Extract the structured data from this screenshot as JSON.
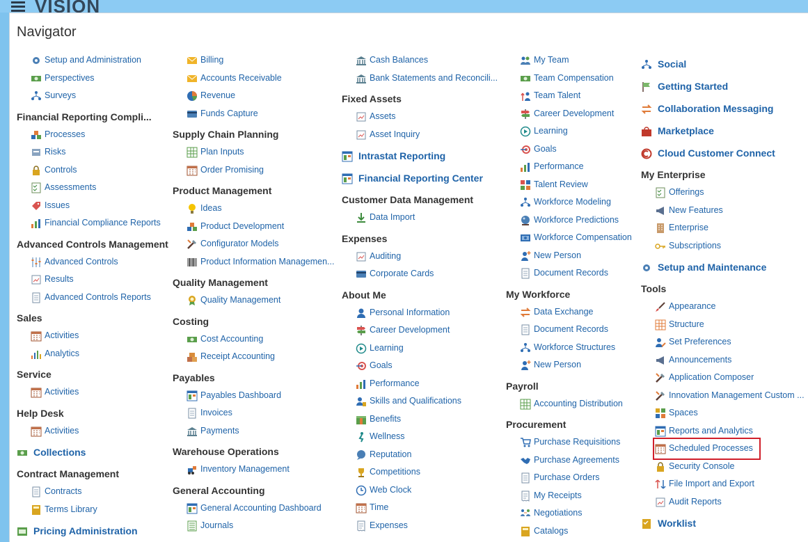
{
  "app": {
    "brand": "VISION"
  },
  "navigator": {
    "title": "Navigator",
    "columns": [
      [
        {
          "kind": "item",
          "label": "Setup and Administration",
          "icon": "gears-icon"
        },
        {
          "kind": "item",
          "label": "Perspectives",
          "icon": "money-icon"
        },
        {
          "kind": "item",
          "label": "Surveys",
          "icon": "hierarchy-icon"
        },
        {
          "kind": "head",
          "label": "Financial Reporting Compli..."
        },
        {
          "kind": "item",
          "label": "Processes",
          "icon": "blocks-icon"
        },
        {
          "kind": "item",
          "label": "Risks",
          "icon": "risk-icon"
        },
        {
          "kind": "item",
          "label": "Controls",
          "icon": "lock-icon"
        },
        {
          "kind": "item",
          "label": "Assessments",
          "icon": "checklist-icon"
        },
        {
          "kind": "item",
          "label": "Issues",
          "icon": "tag-icon"
        },
        {
          "kind": "item",
          "label": "Financial Compliance Reports",
          "icon": "bar-chart-icon"
        },
        {
          "kind": "head",
          "label": "Advanced Controls Management"
        },
        {
          "kind": "item",
          "label": "Advanced Controls",
          "icon": "sliders-icon"
        },
        {
          "kind": "item",
          "label": "Results",
          "icon": "report-icon"
        },
        {
          "kind": "item",
          "label": "Advanced Controls Reports",
          "icon": "document-icon"
        },
        {
          "kind": "head",
          "label": "Sales"
        },
        {
          "kind": "item",
          "label": "Activities",
          "icon": "calendar-icon"
        },
        {
          "kind": "item",
          "label": "Analytics",
          "icon": "analytics-icon"
        },
        {
          "kind": "head",
          "label": "Service"
        },
        {
          "kind": "item",
          "label": "Activities",
          "icon": "calendar-icon"
        },
        {
          "kind": "head",
          "label": "Help Desk"
        },
        {
          "kind": "item",
          "label": "Activities",
          "icon": "calendar-icon"
        },
        {
          "kind": "top",
          "label": "Collections",
          "icon": "money-icon"
        },
        {
          "kind": "head",
          "label": "Contract Management"
        },
        {
          "kind": "item",
          "label": "Contracts",
          "icon": "document-icon"
        },
        {
          "kind": "item",
          "label": "Terms Library",
          "icon": "book-icon"
        },
        {
          "kind": "top",
          "label": "Pricing Administration",
          "icon": "price-icon"
        }
      ],
      [
        {
          "kind": "item",
          "label": "Billing",
          "icon": "envelope-icon"
        },
        {
          "kind": "item",
          "label": "Accounts Receivable",
          "icon": "envelope-icon"
        },
        {
          "kind": "item",
          "label": "Revenue",
          "icon": "pie-chart-icon"
        },
        {
          "kind": "item",
          "label": "Funds Capture",
          "icon": "card-icon"
        },
        {
          "kind": "head",
          "label": "Supply Chain Planning"
        },
        {
          "kind": "item",
          "label": "Plan Inputs",
          "icon": "grid-icon"
        },
        {
          "kind": "item",
          "label": "Order Promising",
          "icon": "calendar-icon"
        },
        {
          "kind": "head",
          "label": "Product Management"
        },
        {
          "kind": "item",
          "label": "Ideas",
          "icon": "lightbulb-icon"
        },
        {
          "kind": "item",
          "label": "Product Development",
          "icon": "blocks-icon"
        },
        {
          "kind": "item",
          "label": "Configurator Models",
          "icon": "tools-icon"
        },
        {
          "kind": "item",
          "label": "Product Information Managemen...",
          "icon": "barcode-icon"
        },
        {
          "kind": "head",
          "label": "Quality Management"
        },
        {
          "kind": "item",
          "label": "Quality Management",
          "icon": "award-icon"
        },
        {
          "kind": "head",
          "label": "Costing"
        },
        {
          "kind": "item",
          "label": "Cost Accounting",
          "icon": "money-icon"
        },
        {
          "kind": "item",
          "label": "Receipt Accounting",
          "icon": "boxes-icon"
        },
        {
          "kind": "head",
          "label": "Payables"
        },
        {
          "kind": "item",
          "label": "Payables Dashboard",
          "icon": "dashboard-icon"
        },
        {
          "kind": "item",
          "label": "Invoices",
          "icon": "document-icon"
        },
        {
          "kind": "item",
          "label": "Payments",
          "icon": "bank-icon"
        },
        {
          "kind": "head",
          "label": "Warehouse Operations"
        },
        {
          "kind": "item",
          "label": "Inventory Management",
          "icon": "forklift-icon"
        },
        {
          "kind": "head",
          "label": "General Accounting"
        },
        {
          "kind": "item",
          "label": "General Accounting Dashboard",
          "icon": "dashboard-icon"
        },
        {
          "kind": "item",
          "label": "Journals",
          "icon": "ledger-icon"
        }
      ],
      [
        {
          "kind": "item",
          "label": "Cash Balances",
          "icon": "bank-icon"
        },
        {
          "kind": "item",
          "label": "Bank Statements and Reconcili...",
          "icon": "bank-icon"
        },
        {
          "kind": "head",
          "label": "Fixed Assets"
        },
        {
          "kind": "item",
          "label": "Assets",
          "icon": "report-icon"
        },
        {
          "kind": "item",
          "label": "Asset Inquiry",
          "icon": "report-icon"
        },
        {
          "kind": "top",
          "label": "Intrastat Reporting",
          "icon": "dashboard-icon"
        },
        {
          "kind": "top",
          "label": "Financial Reporting Center",
          "icon": "dashboard-icon"
        },
        {
          "kind": "head",
          "label": "Customer Data Management"
        },
        {
          "kind": "item",
          "label": "Data Import",
          "icon": "download-icon"
        },
        {
          "kind": "head",
          "label": "Expenses"
        },
        {
          "kind": "item",
          "label": "Auditing",
          "icon": "report-icon"
        },
        {
          "kind": "item",
          "label": "Corporate Cards",
          "icon": "card-icon"
        },
        {
          "kind": "head",
          "label": "About Me"
        },
        {
          "kind": "item",
          "label": "Personal Information",
          "icon": "person-icon"
        },
        {
          "kind": "item",
          "label": "Career Development",
          "icon": "signpost-icon"
        },
        {
          "kind": "item",
          "label": "Learning",
          "icon": "play-icon"
        },
        {
          "kind": "item",
          "label": "Goals",
          "icon": "target-icon"
        },
        {
          "kind": "item",
          "label": "Performance",
          "icon": "bar-chart-icon"
        },
        {
          "kind": "item",
          "label": "Skills and Qualifications",
          "icon": "skills-icon"
        },
        {
          "kind": "item",
          "label": "Benefits",
          "icon": "benefits-icon"
        },
        {
          "kind": "item",
          "label": "Wellness",
          "icon": "wellness-icon"
        },
        {
          "kind": "item",
          "label": "Reputation",
          "icon": "chat-icon"
        },
        {
          "kind": "item",
          "label": "Competitions",
          "icon": "trophy-icon"
        },
        {
          "kind": "item",
          "label": "Web Clock",
          "icon": "clock-icon"
        },
        {
          "kind": "item",
          "label": "Time",
          "icon": "calendar-icon"
        },
        {
          "kind": "item",
          "label": "Expenses",
          "icon": "receipt-icon"
        }
      ],
      [
        {
          "kind": "item",
          "label": "My Team",
          "icon": "team-icon"
        },
        {
          "kind": "item",
          "label": "Team Compensation",
          "icon": "money-icon"
        },
        {
          "kind": "item",
          "label": "Team Talent",
          "icon": "talent-icon"
        },
        {
          "kind": "item",
          "label": "Career Development",
          "icon": "signpost-icon"
        },
        {
          "kind": "item",
          "label": "Learning",
          "icon": "play-icon"
        },
        {
          "kind": "item",
          "label": "Goals",
          "icon": "target-icon"
        },
        {
          "kind": "item",
          "label": "Performance",
          "icon": "bar-chart-icon"
        },
        {
          "kind": "item",
          "label": "Talent Review",
          "icon": "review-icon"
        },
        {
          "kind": "item",
          "label": "Workforce Modeling",
          "icon": "hierarchy-icon"
        },
        {
          "kind": "item",
          "label": "Workforce Predictions",
          "icon": "crystal-ball-icon"
        },
        {
          "kind": "item",
          "label": "Workforce Compensation",
          "icon": "compensation-icon"
        },
        {
          "kind": "item",
          "label": "New Person",
          "icon": "new-person-icon"
        },
        {
          "kind": "item",
          "label": "Document Records",
          "icon": "document-icon"
        },
        {
          "kind": "head",
          "label": "My Workforce"
        },
        {
          "kind": "item",
          "label": "Data Exchange",
          "icon": "exchange-icon"
        },
        {
          "kind": "item",
          "label": "Document Records",
          "icon": "document-icon"
        },
        {
          "kind": "item",
          "label": "Workforce Structures",
          "icon": "hierarchy-icon"
        },
        {
          "kind": "item",
          "label": "New Person",
          "icon": "new-person-icon"
        },
        {
          "kind": "head",
          "label": "Payroll"
        },
        {
          "kind": "item",
          "label": "Accounting Distribution",
          "icon": "grid-icon"
        },
        {
          "kind": "head",
          "label": "Procurement"
        },
        {
          "kind": "item",
          "label": "Purchase Requisitions",
          "icon": "cart-icon"
        },
        {
          "kind": "item",
          "label": "Purchase Agreements",
          "icon": "handshake-icon"
        },
        {
          "kind": "item",
          "label": "Purchase Orders",
          "icon": "document-icon"
        },
        {
          "kind": "item",
          "label": "My Receipts",
          "icon": "receipt-icon"
        },
        {
          "kind": "item",
          "label": "Negotiations",
          "icon": "negotiation-icon"
        },
        {
          "kind": "item",
          "label": "Catalogs",
          "icon": "book-icon"
        }
      ],
      [
        {
          "kind": "top",
          "label": "Social",
          "icon": "hierarchy-icon"
        },
        {
          "kind": "top",
          "label": "Getting Started",
          "icon": "flag-icon"
        },
        {
          "kind": "top",
          "label": "Collaboration Messaging",
          "icon": "exchange-icon"
        },
        {
          "kind": "top",
          "label": "Marketplace",
          "icon": "marketplace-icon"
        },
        {
          "kind": "top",
          "label": "Cloud Customer Connect",
          "icon": "cloud-connect-icon"
        },
        {
          "kind": "head",
          "label": "My Enterprise"
        },
        {
          "kind": "item",
          "label": "Offerings",
          "icon": "checklist-icon"
        },
        {
          "kind": "item",
          "label": "New Features",
          "icon": "megaphone-icon"
        },
        {
          "kind": "item",
          "label": "Enterprise",
          "icon": "building-icon"
        },
        {
          "kind": "item",
          "label": "Subscriptions",
          "icon": "key-icon"
        },
        {
          "kind": "top",
          "label": "Setup and Maintenance",
          "icon": "gears-icon"
        },
        {
          "kind": "head",
          "label": "Tools"
        },
        {
          "kind": "item",
          "label": "Appearance",
          "icon": "brush-icon"
        },
        {
          "kind": "item",
          "label": "Structure",
          "icon": "structure-icon"
        },
        {
          "kind": "item",
          "label": "Set Preferences",
          "icon": "preferences-icon"
        },
        {
          "kind": "item",
          "label": "Announcements",
          "icon": "megaphone-icon"
        },
        {
          "kind": "item",
          "label": "Application Composer",
          "icon": "tools-icon"
        },
        {
          "kind": "item",
          "label": "Innovation Management Custom ...",
          "icon": "tools-icon"
        },
        {
          "kind": "item",
          "label": "Spaces",
          "icon": "spaces-icon"
        },
        {
          "kind": "item",
          "label": "Reports and Analytics",
          "icon": "dashboard-icon"
        },
        {
          "kind": "item",
          "label": "Scheduled Processes",
          "icon": "calendar-icon"
        },
        {
          "kind": "item",
          "label": "Security Console",
          "icon": "lock-icon"
        },
        {
          "kind": "item",
          "label": "File Import and Export",
          "icon": "file-transfer-icon"
        },
        {
          "kind": "item",
          "label": "Audit Reports",
          "icon": "report-icon"
        },
        {
          "kind": "top",
          "label": "Worklist",
          "icon": "worklist-icon"
        }
      ]
    ]
  },
  "highlight": {
    "label": "Scheduled Processes",
    "color": "#d01f2a"
  },
  "colors": {
    "link": "#1f63a8",
    "heading": "#333333",
    "topbar": "#8ccbf3",
    "background": "#7fc3ee"
  }
}
